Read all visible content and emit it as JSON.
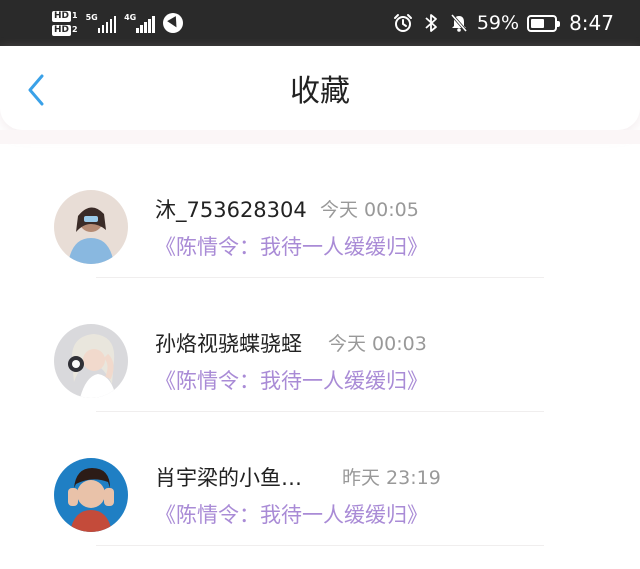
{
  "status_bar": {
    "sim1_label": "HD",
    "sim1_num": "1",
    "sim2_label": "HD",
    "sim2_num": "2",
    "sig1_network": "5G",
    "sig2_network": "4G",
    "battery_percent": "59%",
    "battery_level": 0.59,
    "time": "8:47",
    "icons": [
      "alarm-icon",
      "bluetooth-icon",
      "mute-bell-icon",
      "battery-icon"
    ]
  },
  "header": {
    "back_icon": "chevron-left-icon",
    "title": "收藏"
  },
  "favorites": [
    {
      "name": "沐_753628304",
      "time": "今天 00:05",
      "title": "《陈情令：我待一人缓缓归》"
    },
    {
      "name": "孙烙视骁蝶骁蛏",
      "time": "今天 00:03",
      "title": "《陈情令：我待一人缓缓归》"
    },
    {
      "name": "肖宇梁的小鱼…",
      "time": "昨天 23:19",
      "title": "《陈情令：我待一人缓缓归》"
    }
  ],
  "colors": {
    "status_bar_bg": "#2a2a2a",
    "accent_blue": "#3aa1e8",
    "title_purple": "#a98bd6",
    "time_gray": "#999999"
  }
}
